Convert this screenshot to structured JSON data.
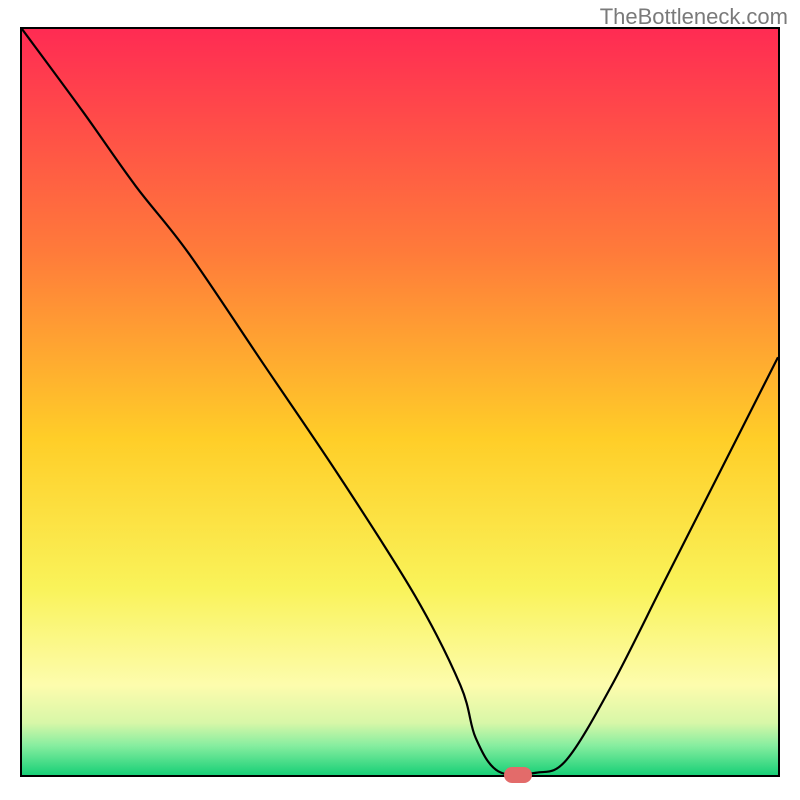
{
  "watermark": "TheBottleneck.com",
  "chart_data": {
    "type": "line",
    "title": "",
    "xlabel": "",
    "ylabel": "",
    "xlim": [
      0,
      100
    ],
    "ylim": [
      0,
      100
    ],
    "grid": false,
    "series": [
      {
        "name": "curve",
        "x": [
          0,
          8,
          15,
          22,
          32,
          42,
          52,
          58,
          60,
          63,
          68,
          72,
          78,
          85,
          92,
          100
        ],
        "y": [
          100,
          89,
          79,
          70,
          55,
          40,
          24,
          12,
          5,
          0.5,
          0.3,
          2,
          12,
          26,
          40,
          56
        ]
      }
    ],
    "gradient_stops": [
      {
        "offset": 0,
        "color": "#ff2b53"
      },
      {
        "offset": 30,
        "color": "#ff7b3a"
      },
      {
        "offset": 55,
        "color": "#ffce28"
      },
      {
        "offset": 75,
        "color": "#f9f35a"
      },
      {
        "offset": 88,
        "color": "#fdfcad"
      },
      {
        "offset": 93,
        "color": "#d8f7a8"
      },
      {
        "offset": 96,
        "color": "#88eea0"
      },
      {
        "offset": 100,
        "color": "#18d077"
      }
    ],
    "marker": {
      "x": 65.2,
      "y": 0.6,
      "color": "#e36b6a"
    }
  }
}
